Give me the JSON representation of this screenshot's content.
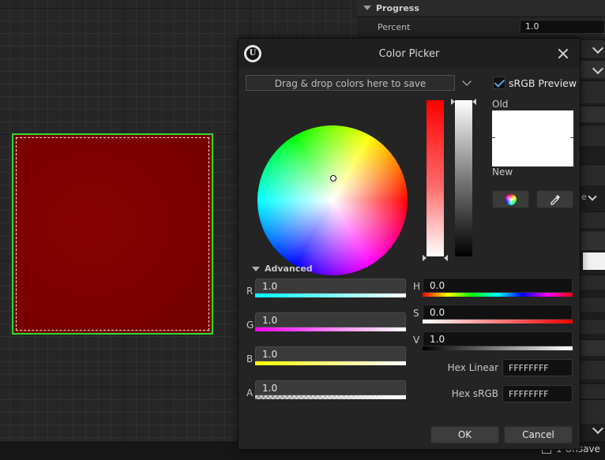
{
  "details": {
    "category": "Progress",
    "percent_label": "Percent",
    "percent_value": "1.0"
  },
  "status": {
    "unsaved": "1 Unsave"
  },
  "dialog": {
    "title": "Color Picker",
    "dropzone": "Drag & drop colors here to save",
    "srgb_preview": "sRGB Preview",
    "srgb_checked": true,
    "old_label": "Old",
    "new_label": "New",
    "advanced": "Advanced",
    "channels": {
      "r": {
        "label": "R",
        "value": "1.0"
      },
      "g": {
        "label": "G",
        "value": "1.0"
      },
      "b": {
        "label": "B",
        "value": "1.0"
      },
      "a": {
        "label": "A",
        "value": "1.0"
      },
      "h": {
        "label": "H",
        "value": "0.0"
      },
      "s": {
        "label": "S",
        "value": "0.0"
      },
      "v": {
        "label": "V",
        "value": "1.0"
      }
    },
    "hex_linear_label": "Hex Linear",
    "hex_linear_value": "FFFFFFFF",
    "hex_srgb_label": "Hex sRGB",
    "hex_srgb_value": "FFFFFFFF",
    "ok": "OK",
    "cancel": "Cancel"
  },
  "colors": {
    "widget_fill": "#7d0000",
    "selection_outline": "#2ed92e",
    "old_color": "#ffffff",
    "accent": "#4a9fe8"
  }
}
